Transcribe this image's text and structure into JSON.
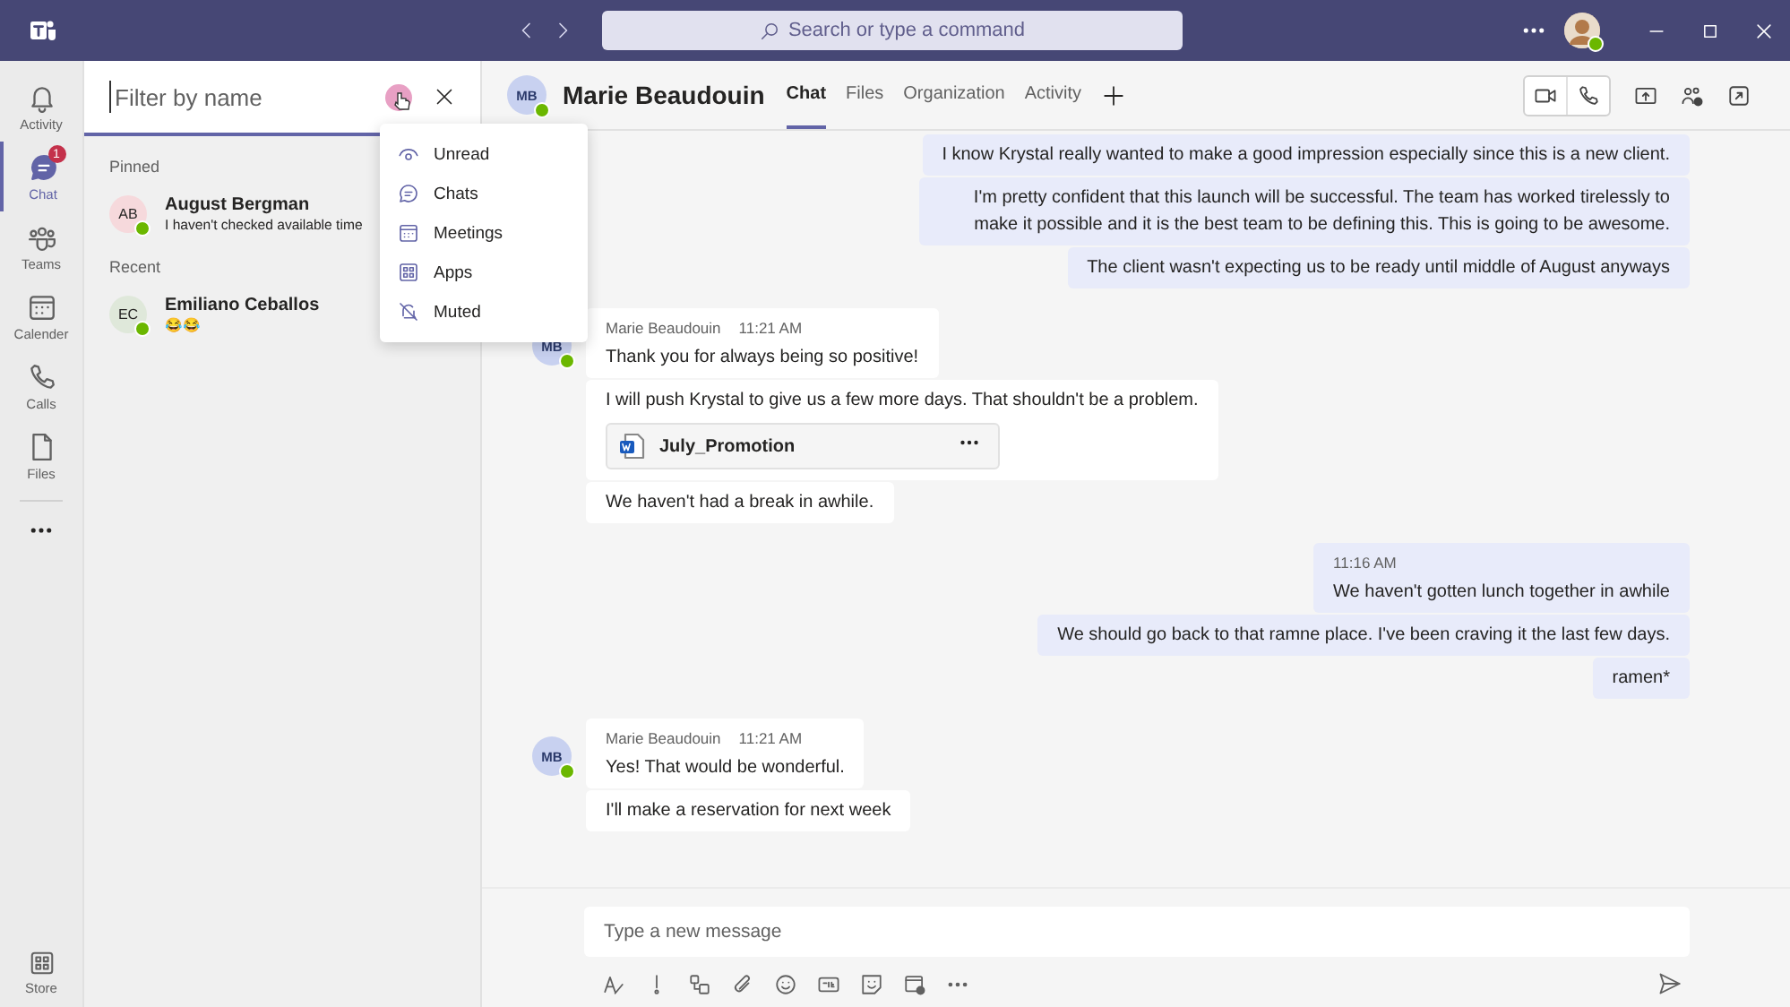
{
  "title_bar": {
    "search": {
      "placeholder": "Search or type a command"
    }
  },
  "rail": [
    {
      "label": "Activity",
      "kind": "bell",
      "selected": false
    },
    {
      "label": "Chat",
      "kind": "chat",
      "selected": true,
      "badge": "1"
    },
    {
      "label": "Teams",
      "kind": "teams",
      "selected": false
    },
    {
      "label": "Calender",
      "kind": "calendar",
      "selected": false
    },
    {
      "label": "Calls",
      "kind": "phone",
      "selected": false
    },
    {
      "label": "Files",
      "kind": "file",
      "selected": false
    }
  ],
  "rail_bottom": {
    "label": "Store"
  },
  "filter": {
    "placeholder": "Filter by name",
    "menu": [
      {
        "label": "Unread",
        "kind": "unread"
      },
      {
        "label": "Chats",
        "kind": "chats"
      },
      {
        "label": "Meetings",
        "kind": "meetings"
      },
      {
        "label": "Apps",
        "kind": "apps"
      },
      {
        "label": "Muted",
        "kind": "muted"
      }
    ]
  },
  "chat_sections": [
    {
      "title": "Pinned",
      "chats": [
        {
          "initials": "AB",
          "color": "#f6d9dc",
          "name": "August Bergman",
          "preview": "I haven't checked available time"
        }
      ]
    },
    {
      "title": "Recent",
      "chats": [
        {
          "initials": "EC",
          "color": "#dfe8da",
          "name": "Emiliano Ceballos",
          "preview": "😂😂"
        }
      ]
    }
  ],
  "conversation": {
    "initials": "MB",
    "name": "Marie Beaudouin",
    "tabs": [
      {
        "label": "Chat",
        "selected": true
      },
      {
        "label": "Files",
        "selected": false
      },
      {
        "label": "Organization",
        "selected": false
      },
      {
        "label": "Activity",
        "selected": false
      }
    ]
  },
  "messages": [
    {
      "kind": "sent",
      "bubbles": [
        {
          "text": "I know Krystal really wanted to make a good impression especially since this is a new client."
        },
        {
          "text": "I'm pretty confident that this launch will be successful. The team has worked tirelessly to make it possible and it is the best team to be defining this. This is going to be awesome."
        },
        {
          "text": "The client wasn't expecting us to be ready until middle of August anyways"
        }
      ]
    },
    {
      "kind": "received",
      "initials": "MB",
      "sender": "Marie Beaudouin",
      "time": "11:21 AM",
      "bubbles": [
        {
          "text": "Thank you for always being so positive!"
        },
        {
          "text": "I will push Krystal to give us a few more days. That shouldn't be a problem.",
          "attachment": "July_Promotion"
        },
        {
          "text": "We haven't had a break in awhile."
        }
      ]
    },
    {
      "kind": "sent",
      "time": "11:16 AM",
      "bubbles": [
        {
          "text": "We haven't gotten lunch together in awhile"
        },
        {
          "text": "We should go back to that ramne place. I've been craving it the last few days."
        },
        {
          "text": "ramen*"
        }
      ]
    },
    {
      "kind": "received",
      "initials": "MB",
      "sender": "Marie Beaudouin",
      "time": "11:21 AM",
      "bubbles": [
        {
          "text": "Yes! That would be wonderful."
        },
        {
          "text": "I'll make a reservation for next week"
        }
      ]
    }
  ],
  "composer": {
    "placeholder": "Type a new message"
  }
}
